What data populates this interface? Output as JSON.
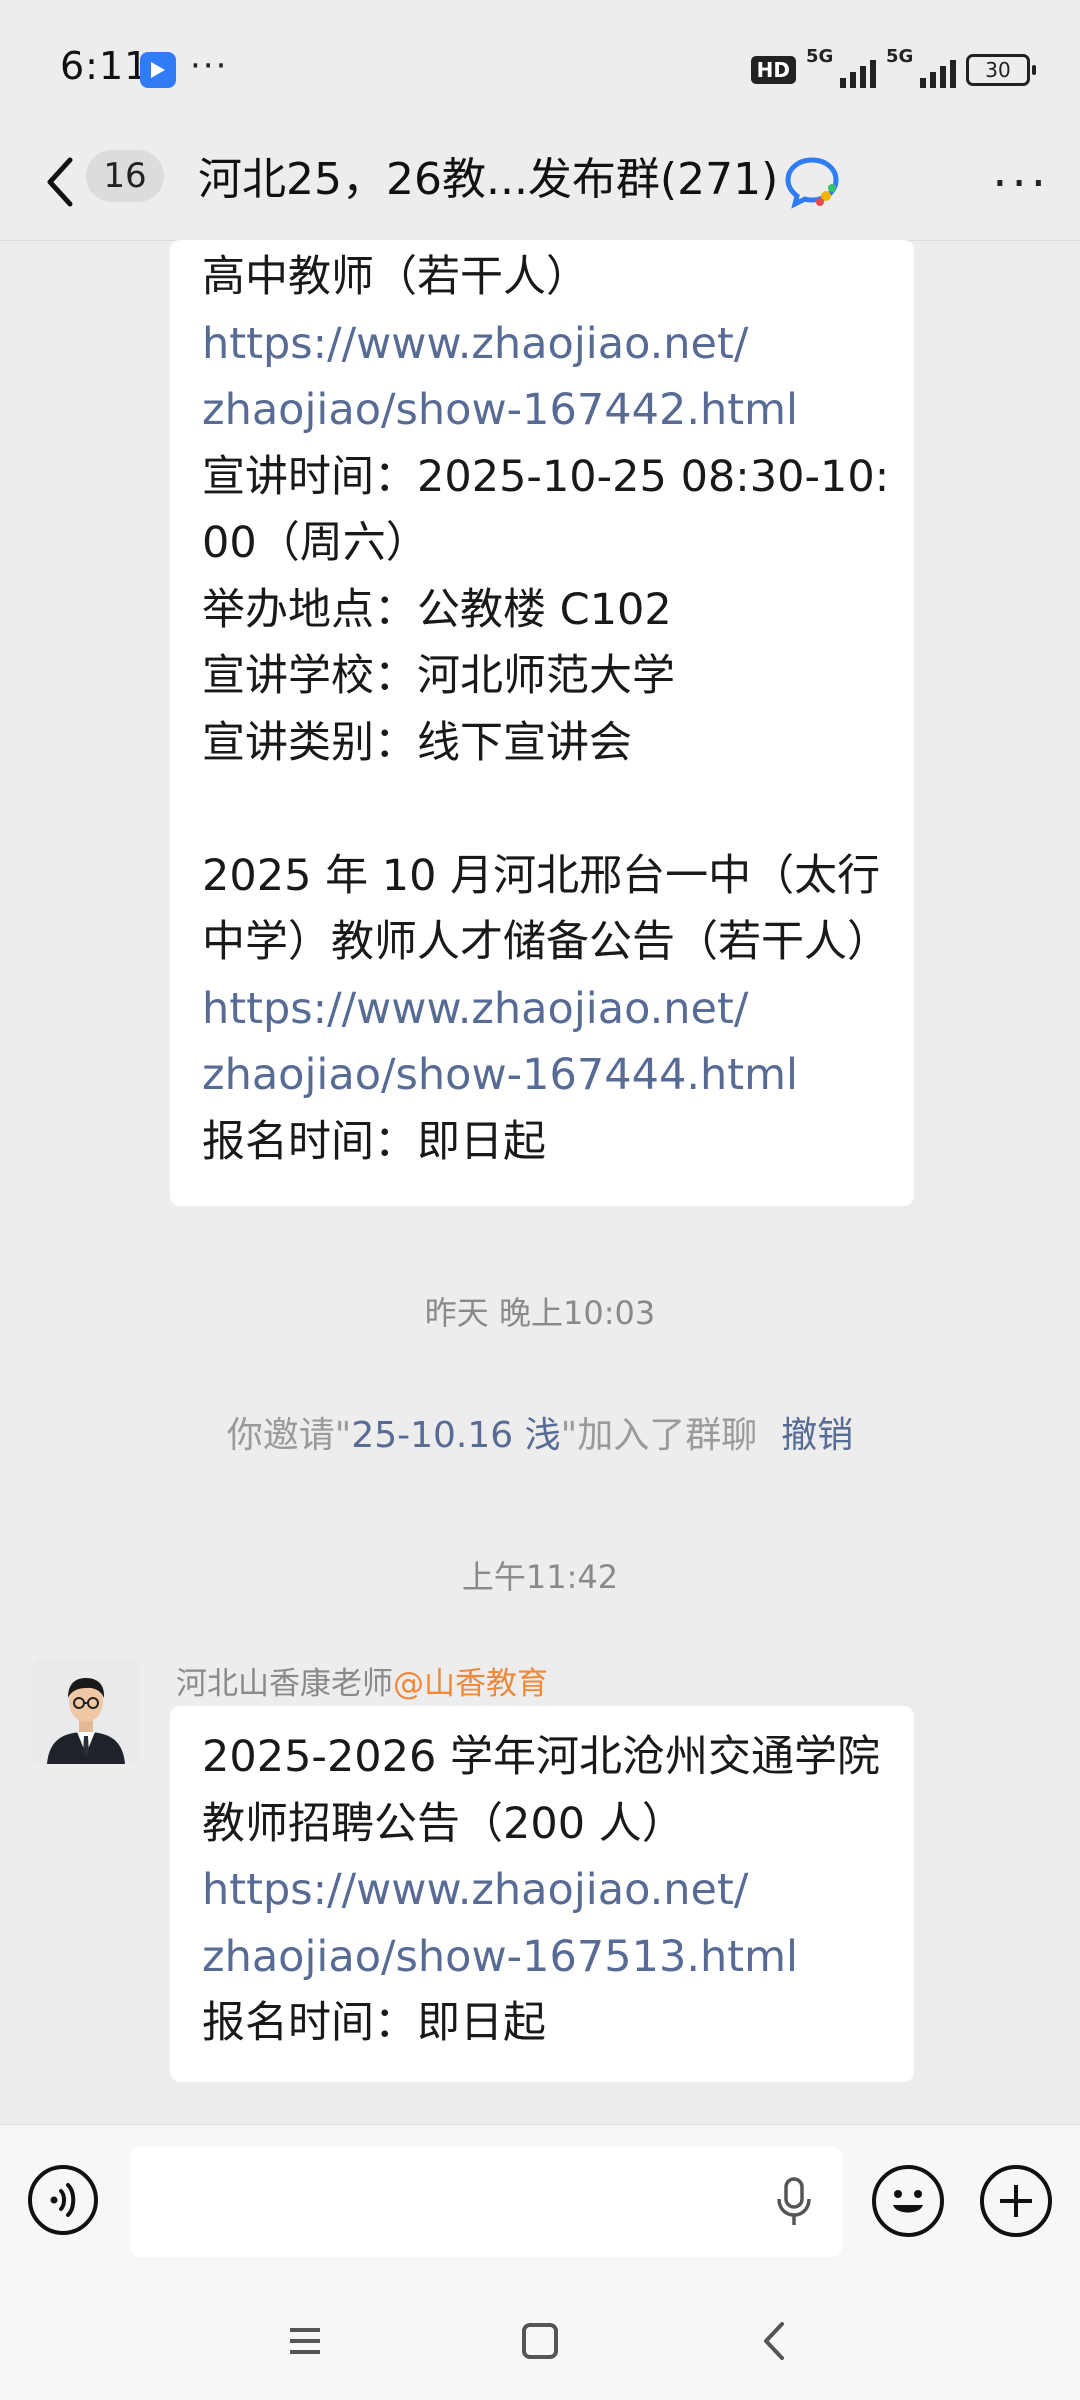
{
  "status_bar": {
    "time": "6:11",
    "overflow": "···",
    "hd_label": "HD",
    "sim1_label": "5G",
    "sim2_label": "5G",
    "battery": "30"
  },
  "header": {
    "unread_count": "16",
    "title": "河北25，26教...发布群(271)",
    "more": "···"
  },
  "messages": {
    "bubble1_lines": [
      {
        "text": "高中教师（若干人）",
        "link": false
      },
      {
        "text": "https://www.zhaojiao.net/",
        "link": true
      },
      {
        "text": "zhaojiao/show-167442.html",
        "link": true
      },
      {
        "text": "宣讲时间：2025-10-25 08:30-10:",
        "link": false
      },
      {
        "text": "00（周六）",
        "link": false
      },
      {
        "text": "举办地点：公教楼 C102",
        "link": false
      },
      {
        "text": "宣讲学校：河北师范大学",
        "link": false
      },
      {
        "text": "宣讲类别：线下宣讲会",
        "link": false
      },
      {
        "text": " ",
        "link": false
      },
      {
        "text": "2025 年 10 月河北邢台一中（太行",
        "link": false
      },
      {
        "text": "中学）教师人才储备公告（若干人）",
        "link": false
      },
      {
        "text": "https://www.zhaojiao.net/",
        "link": true
      },
      {
        "text": "zhaojiao/show-167444.html",
        "link": true
      },
      {
        "text": "报名时间：即日起",
        "link": false
      }
    ],
    "timestamp1": "昨天 晚上10:03",
    "system": {
      "prefix": "你邀请\"",
      "name": "25-10.16 浅",
      "suffix": "\"加入了群聊",
      "undo": "撤销"
    },
    "timestamp2": "上午11:42",
    "sender_name": "河北山香康老师",
    "sender_org": "@山香教育",
    "bubble2_lines": [
      {
        "text": "2025-2026 学年河北沧州交通学院",
        "link": false
      },
      {
        "text": "教师招聘公告（200 人）",
        "link": false
      },
      {
        "text": "https://www.zhaojiao.net/",
        "link": true
      },
      {
        "text": "zhaojiao/show-167513.html",
        "link": true
      },
      {
        "text": "报名时间：即日起",
        "link": false
      }
    ]
  },
  "input_bar": {
    "voice_icon": "voice-toggle-icon",
    "mic_icon": "mic-icon",
    "emoji_icon": "emoji-icon",
    "plus_icon": "plus-icon"
  },
  "nav_bar": {
    "icons": [
      "menu-icon",
      "home-icon",
      "back-icon"
    ]
  },
  "colors": {
    "background": "#ededed",
    "link": "#576b95",
    "org": "#f0883a",
    "bubble": "#ffffff"
  }
}
